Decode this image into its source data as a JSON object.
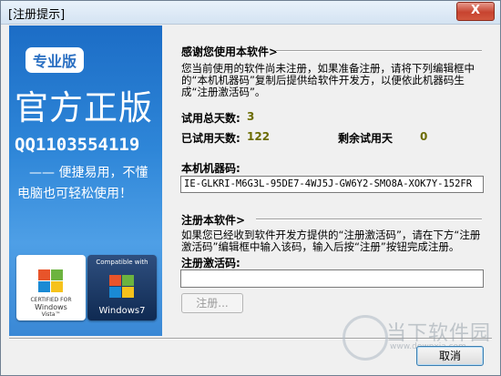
{
  "window": {
    "title": "[注册提示]",
    "close_label": "X"
  },
  "banner": {
    "badge": "专业版",
    "title": "官方正版",
    "qq": "QQ1103554119",
    "slogan_line1": "—— 便捷易用，不懂",
    "slogan_line2": "电脑也可轻松使用！",
    "vista_logo": {
      "cert_line1": "CERTIFIED FOR",
      "cert_line2": "Windows",
      "cert_line3": "Vista™"
    },
    "win7_logo": {
      "top_text": "Compatible with",
      "bottom_text": "Windows7"
    }
  },
  "thanks": {
    "heading": "感谢您使用本软件>",
    "paragraph": "您当前使用的软件尚未注册，如果准备注册，请将下列编辑框中的“本机机器码”复制后提供给软件开发方，以便依此机器码生成“注册激活码”。",
    "trial_total_label": "试用总天数:",
    "trial_total_value": "3",
    "trial_used_label": "已试用天数:",
    "trial_used_value": "122",
    "trial_remain_label": "剩余试用天",
    "trial_remain_value": "0"
  },
  "machine": {
    "label": "本机机器码:",
    "code": "IE-GLKRI-M6G3L-95DE7-4WJ5J-GW6Y2-SMO8A-XOK7Y-152FR"
  },
  "register": {
    "heading": "注册本软件>",
    "paragraph": "如果您已经收到软件开发方提供的“注册激活码”，请在下方“注册激活码”编辑框中输入该码，输入后按“注册”按钮完成注册。",
    "activation_label": "注册激活码:",
    "activation_value": "",
    "register_button": "注册...",
    "cancel_button": "取消"
  },
  "watermark": {
    "text": "当下软件园",
    "url": "www.downxia.com"
  }
}
